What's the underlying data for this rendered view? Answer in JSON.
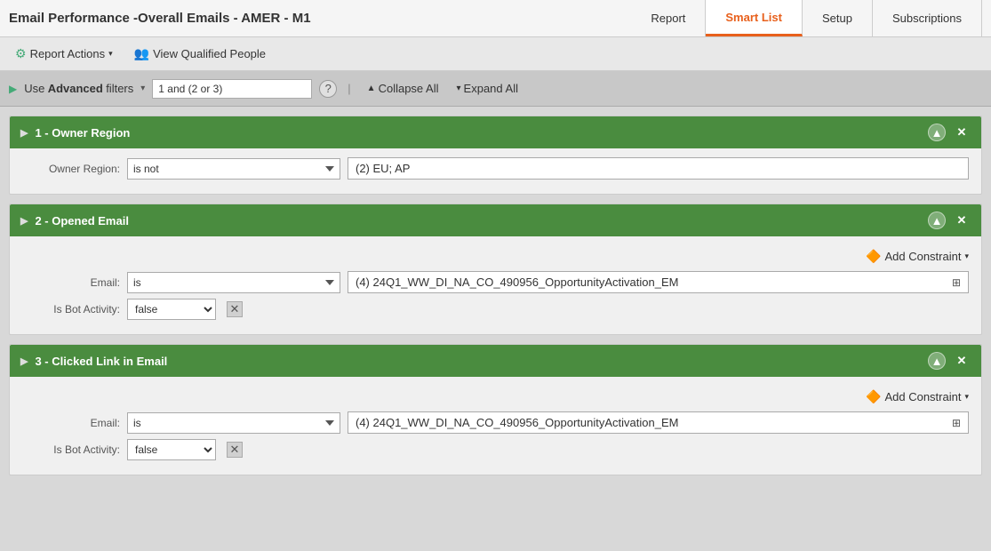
{
  "title": "Email Performance -Overall Emails - AMER - M1",
  "tabs": [
    {
      "id": "report",
      "label": "Report",
      "active": false
    },
    {
      "id": "smartlist",
      "label": "Smart List",
      "active": true
    },
    {
      "id": "setup",
      "label": "Setup",
      "active": false
    },
    {
      "id": "subscriptions",
      "label": "Subscriptions",
      "active": false
    }
  ],
  "toolbar": {
    "report_actions_label": "Report Actions",
    "view_qualified_label": "View Qualified People"
  },
  "filter_bar": {
    "use_label": "Use",
    "advanced_label": "Advanced",
    "filters_label": "filters",
    "filter_expression": "1 and (2 or 3)",
    "help_icon": "?",
    "separator": "|",
    "collapse_label": "Collapse All",
    "expand_label": "Expand All"
  },
  "filter_groups": [
    {
      "id": 1,
      "title": "1 - Owner Region",
      "fields": [
        {
          "label": "Owner Region:",
          "operator": "is not",
          "value": "(2) EU; AP",
          "type": "text-value"
        }
      ],
      "has_add_constraint": false
    },
    {
      "id": 2,
      "title": "2 - Opened Email",
      "has_add_constraint": true,
      "add_constraint_label": "Add Constraint",
      "fields": [
        {
          "label": "Email:",
          "operator": "is",
          "value": "(4) 24Q1_WW_DI_NA_CO_490956_OpportunityActivation_EM",
          "type": "text-value"
        },
        {
          "label": "Is Bot Activity:",
          "operator": "false",
          "type": "select-only"
        }
      ]
    },
    {
      "id": 3,
      "title": "3 - Clicked Link in Email",
      "has_add_constraint": true,
      "add_constraint_label": "Add Constraint",
      "fields": [
        {
          "label": "Email:",
          "operator": "is",
          "value": "(4) 24Q1_WW_DI_NA_CO_490956_OpportunityActivation_EM",
          "type": "text-value"
        },
        {
          "label": "Is Bot Activity:",
          "operator": "false",
          "type": "select-only"
        }
      ]
    }
  ]
}
